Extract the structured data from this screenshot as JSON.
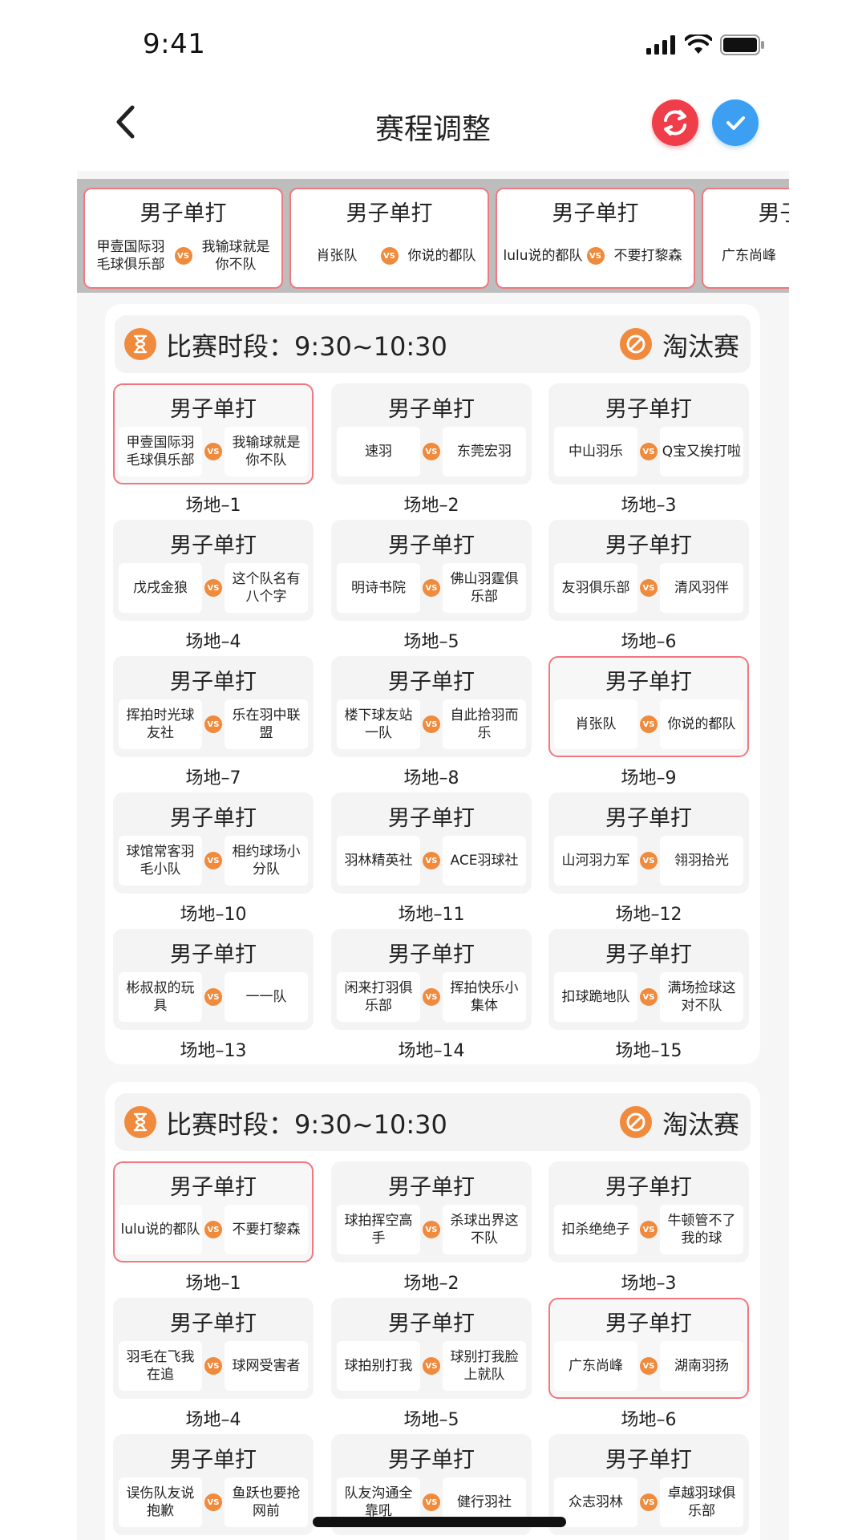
{
  "status": {
    "time": "9:41"
  },
  "nav": {
    "title": "赛程调整"
  },
  "tray": [
    {
      "title": "男子单打",
      "team_a": "甲壹国际羽毛球俱乐部",
      "team_b": "我输球就是你不队",
      "vs": "vs"
    },
    {
      "title": "男子单打",
      "team_a": "肖张队",
      "team_b": "你说的都队",
      "vs": "vs"
    },
    {
      "title": "男子单打",
      "team_a": "lulu说的都队",
      "team_b": "不要打黎森",
      "vs": "vs"
    },
    {
      "title": "男子单打",
      "team_a": "广东尚峰",
      "team_b": "",
      "vs": "vs"
    }
  ],
  "sections": [
    {
      "period": "比赛时段：9:30~10:30",
      "type": "淘汰赛",
      "matches": [
        {
          "title": "男子单打",
          "team_a": "甲壹国际羽毛球俱乐部",
          "team_b": "我输球就是你不队",
          "court": "场地–1",
          "highlighted": true
        },
        {
          "title": "男子单打",
          "team_a": "速羽",
          "team_b": "东莞宏羽",
          "court": "场地–2",
          "highlighted": false
        },
        {
          "title": "男子单打",
          "team_a": "中山羽乐",
          "team_b": "Q宝又挨打啦",
          "court": "场地–3",
          "highlighted": false
        },
        {
          "title": "男子单打",
          "team_a": "戊戌金狼",
          "team_b": "这个队名有八个字",
          "court": "场地–4",
          "highlighted": false
        },
        {
          "title": "男子单打",
          "team_a": "明诗书院",
          "team_b": "佛山羽霆俱乐部",
          "court": "场地–5",
          "highlighted": false
        },
        {
          "title": "男子单打",
          "team_a": "友羽俱乐部",
          "team_b": "清风羽伴",
          "court": "场地–6",
          "highlighted": false
        },
        {
          "title": "男子单打",
          "team_a": "挥拍时光球友社",
          "team_b": "乐在羽中联盟",
          "court": "场地–7",
          "highlighted": false
        },
        {
          "title": "男子单打",
          "team_a": "楼下球友站一队",
          "team_b": "自此拾羽而乐",
          "court": "场地–8",
          "highlighted": false
        },
        {
          "title": "男子单打",
          "team_a": "肖张队",
          "team_b": "你说的都队",
          "court": "场地–9",
          "highlighted": true
        },
        {
          "title": "男子单打",
          "team_a": "球馆常客羽毛小队",
          "team_b": "相约球场小分队",
          "court": "场地–10",
          "highlighted": false
        },
        {
          "title": "男子单打",
          "team_a": "羽林精英社",
          "team_b": "ACE羽球社",
          "court": "场地–11",
          "highlighted": false
        },
        {
          "title": "男子单打",
          "team_a": "山河羽力军",
          "team_b": "翎羽拾光",
          "court": "场地–12",
          "highlighted": false
        },
        {
          "title": "男子单打",
          "team_a": "彬叔叔的玩具",
          "team_b": "一一队",
          "court": "场地–13",
          "highlighted": false
        },
        {
          "title": "男子单打",
          "team_a": "闲来打羽俱乐部",
          "team_b": "挥拍快乐小集体",
          "court": "场地–14",
          "highlighted": false
        },
        {
          "title": "男子单打",
          "team_a": "扣球跪地队",
          "team_b": "满场捡球这对不队",
          "court": "场地–15",
          "highlighted": false
        }
      ]
    },
    {
      "period": "比赛时段：9:30~10:30",
      "type": "淘汰赛",
      "matches": [
        {
          "title": "男子单打",
          "team_a": "lulu说的都队",
          "team_b": "不要打黎森",
          "court": "场地–1",
          "highlighted": true
        },
        {
          "title": "男子单打",
          "team_a": "球拍挥空高手",
          "team_b": "杀球出界这不队",
          "court": "场地–2",
          "highlighted": false
        },
        {
          "title": "男子单打",
          "team_a": "扣杀绝绝子",
          "team_b": "牛顿管不了我的球",
          "court": "场地–3",
          "highlighted": false
        },
        {
          "title": "男子单打",
          "team_a": "羽毛在飞我在追",
          "team_b": "球网受害者",
          "court": "场地–4",
          "highlighted": false
        },
        {
          "title": "男子单打",
          "team_a": "球拍别打我",
          "team_b": "球别打我脸上就队",
          "court": "场地–5",
          "highlighted": false
        },
        {
          "title": "男子单打",
          "team_a": "广东尚峰",
          "team_b": "湖南羽扬",
          "court": "场地–6",
          "highlighted": true
        },
        {
          "title": "男子单打",
          "team_a": "误伤队友说抱歉",
          "team_b": "鱼跃也要抢网前",
          "court": "",
          "highlighted": false
        },
        {
          "title": "男子单打",
          "team_a": "队友沟通全靠吼",
          "team_b": "健行羽社",
          "court": "",
          "highlighted": false
        },
        {
          "title": "男子单打",
          "team_a": "众志羽林",
          "team_b": "卓越羽球俱乐部",
          "court": "",
          "highlighted": false
        }
      ]
    }
  ]
}
